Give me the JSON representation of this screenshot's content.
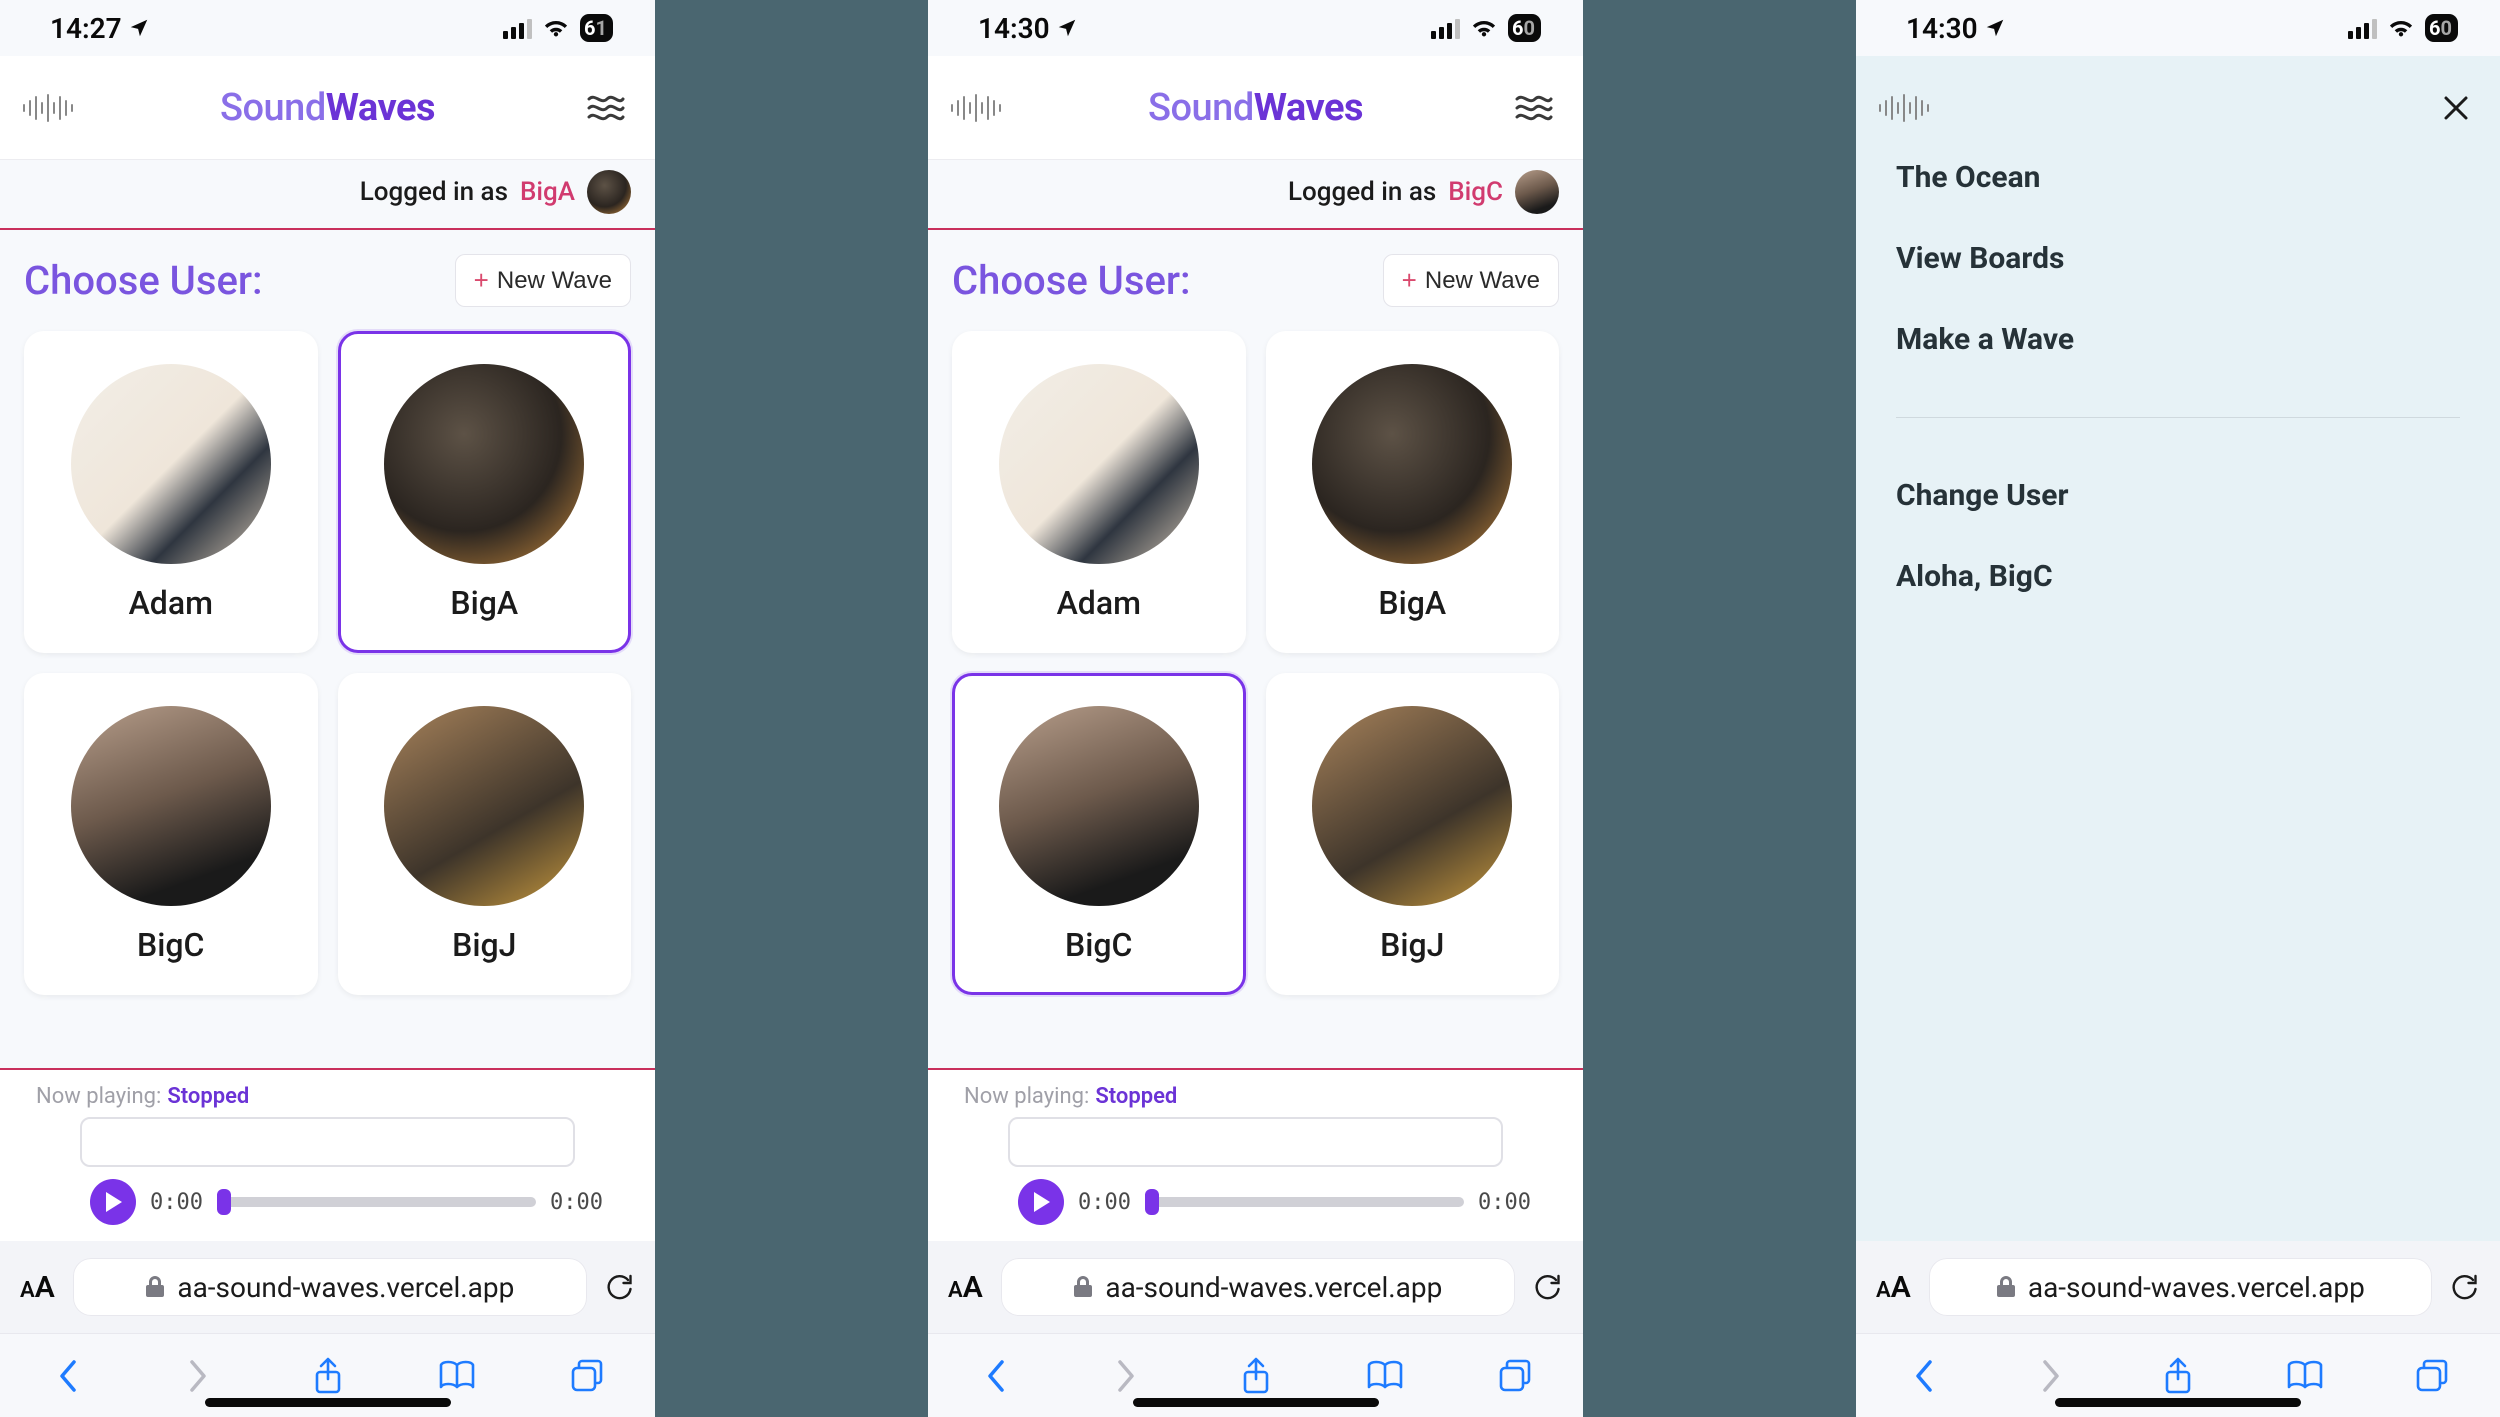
{
  "brand": {
    "part1": "Sound",
    "part2": "Waves"
  },
  "status": {
    "time1": "14:27",
    "time2": "14:30",
    "time3": "14:30",
    "battery1": {
      "d1": "6",
      "d2": "1"
    },
    "battery2": {
      "d1": "6",
      "d2": "0"
    },
    "battery3": {
      "d1": "6",
      "d2": "0"
    }
  },
  "login": {
    "prefix": "Logged in as",
    "users": {
      "a": "BigA",
      "c": "BigC"
    }
  },
  "choose_user_heading": "Choose User:",
  "new_wave_label": "New Wave",
  "users": [
    {
      "name": "Adam"
    },
    {
      "name": "BigA"
    },
    {
      "name": "BigC"
    },
    {
      "name": "BigJ"
    }
  ],
  "now_playing": {
    "label": "Now playing:",
    "state": "Stopped",
    "elapsed": "0:00",
    "total": "0:00"
  },
  "safari": {
    "url": "aa-sound-waves.vercel.app"
  },
  "menu": {
    "items": {
      "ocean": "The Ocean",
      "boards": "View Boards",
      "make": "Make a Wave",
      "change": "Change User",
      "aloha": "Aloha, BigC"
    }
  },
  "avatar_bg": {
    "adam": "linear-gradient(135deg,#f2eee7 0%,#efe6da 50%,#2f3640 70%,#d8c9b5 100%)",
    "biga": "radial-gradient(circle at 40% 35%, #5d5246 0%, #2b2520 55%, #c98a3d 100%)",
    "bigc": "linear-gradient(160deg,#b79e8b 0%,#6d5a4c 45%,#1a1a1a 80%)",
    "bigj": "linear-gradient(150deg,#a8835b 0%,#3d342a 60%,#c99a3e 100%)"
  }
}
